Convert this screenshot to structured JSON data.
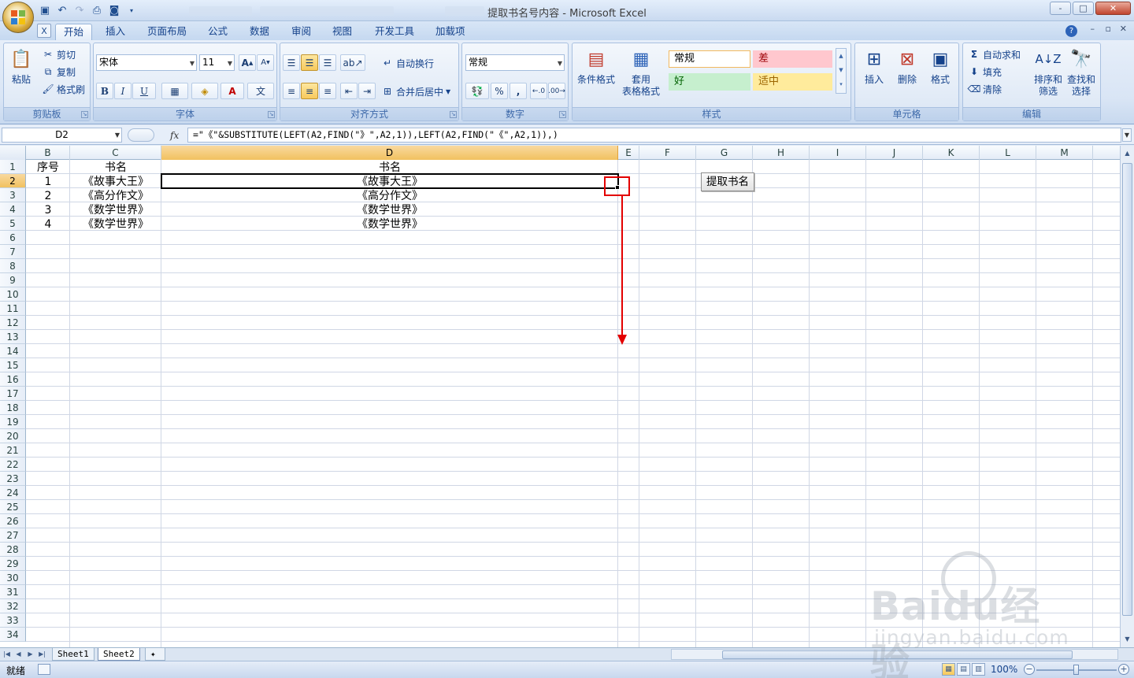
{
  "window": {
    "title": "提取书名号内容 - Microsoft Excel",
    "controls": [
      "-",
      "□",
      "✕"
    ]
  },
  "ribbon_tabs": [
    "开始",
    "插入",
    "页面布局",
    "公式",
    "数据",
    "审阅",
    "视图",
    "开发工具",
    "加载项"
  ],
  "ribbon": {
    "clipboard": {
      "title": "剪贴板",
      "paste": "粘贴",
      "cut": "剪切",
      "copy": "复制",
      "format_painter": "格式刷"
    },
    "font": {
      "title": "字体",
      "name": "宋体",
      "size": "11",
      "bold": "B",
      "italic": "I",
      "underline": "U"
    },
    "alignment": {
      "title": "对齐方式",
      "wrap": "自动换行",
      "merge": "合并后居中"
    },
    "number": {
      "title": "数字",
      "format": "常规",
      "percent": "%",
      "comma": ","
    },
    "styles": {
      "title": "样式",
      "conditional": "条件格式",
      "table": "套用",
      "table2": "表格格式",
      "normal": "常规",
      "bad": "差",
      "good": "好",
      "neutral": "适中"
    },
    "cells": {
      "title": "单元格",
      "insert": "插入",
      "delete": "删除",
      "format": "格式"
    },
    "editing": {
      "title": "编辑",
      "autosum": "自动求和",
      "fill": "填充",
      "clear": "清除",
      "sort": "排序和",
      "sort2": "筛选",
      "find": "查找和",
      "find2": "选择"
    }
  },
  "formula_bar": {
    "name_box": "D2",
    "fx": "fx",
    "formula": "=\"《\"&SUBSTITUTE(LEFT(A2,FIND(\"》\",A2,1)),LEFT(A2,FIND(\"《\",A2,1)),)"
  },
  "columns": [
    "B",
    "C",
    "D",
    "E",
    "F",
    "G",
    "H",
    "I",
    "J",
    "K",
    "L",
    "M"
  ],
  "rows": [
    "1",
    "2",
    "3",
    "4",
    "5",
    "6",
    "7",
    "8",
    "9",
    "10",
    "11",
    "12",
    "13",
    "14",
    "15",
    "16",
    "17",
    "18",
    "19",
    "20",
    "21",
    "22",
    "23",
    "24",
    "25",
    "26",
    "27",
    "28",
    "29",
    "30",
    "31",
    "32",
    "33",
    "34"
  ],
  "cells": {
    "B1": "序号",
    "C1": "书名",
    "D1": "书名",
    "B2": "1",
    "C2": "《故事大王》",
    "D2": "《故事大王》",
    "B3": "2",
    "C3": "《高分作文》",
    "D3": "《高分作文》",
    "B4": "3",
    "C4": "《数学世界》",
    "D4": "《数学世界》",
    "B5": "4",
    "C5": "《数学世界》",
    "D5": "《数学世界》"
  },
  "sheet_button": "提取书名",
  "sheet_tabs": [
    "Sheet1",
    "Sheet2"
  ],
  "status": {
    "ready": "就绪",
    "zoom": "100%"
  },
  "watermark": {
    "text": "Baidu经验",
    "sub": "jingyan.baidu.com"
  },
  "colors": {
    "accent": "#15428b",
    "selected_header": "#f1c15f",
    "annotation": "#e30000"
  }
}
